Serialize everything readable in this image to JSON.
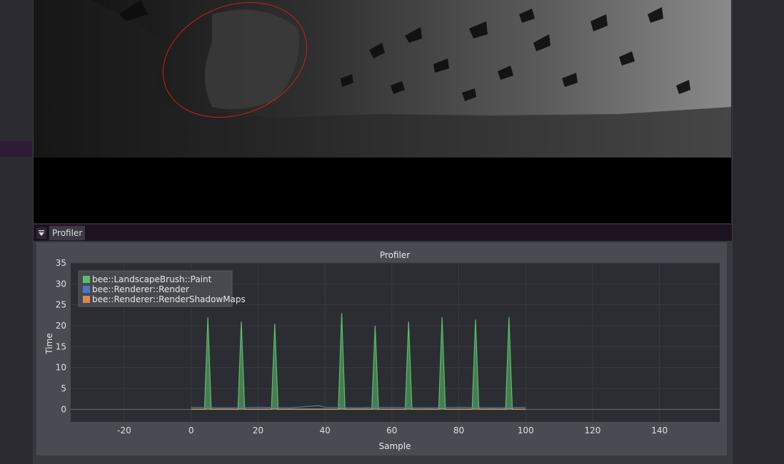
{
  "window": {
    "dock_tab_label": "Profiler"
  },
  "icons": {
    "collapse": "triangle-down-icon"
  },
  "colors": {
    "ellipse": "#cc1f1f",
    "series_paint": "#5bbf6a",
    "series_render": "#4a78c8",
    "series_shadow": "#e0874e"
  },
  "chart_data": {
    "type": "area",
    "title": "Profiler",
    "xlabel": "Sample",
    "ylabel": "Time",
    "xlim": [
      -36,
      158
    ],
    "ylim": [
      -3,
      35
    ],
    "x_ticks": [
      -20,
      0,
      20,
      40,
      60,
      80,
      100,
      120,
      140
    ],
    "y_ticks": [
      0,
      5,
      10,
      15,
      20,
      25,
      30,
      35
    ],
    "grid": true,
    "legend_position": "top-left",
    "series": [
      {
        "name": "bee::LandscapeBrush::Paint",
        "color": "#5bbf6a",
        "points": [
          [
            0,
            0
          ],
          [
            4,
            0
          ],
          [
            5,
            22
          ],
          [
            6,
            0
          ],
          [
            14,
            0
          ],
          [
            15,
            21
          ],
          [
            16,
            0
          ],
          [
            24,
            0
          ],
          [
            25,
            20.5
          ],
          [
            26,
            0
          ],
          [
            44,
            0
          ],
          [
            45,
            23
          ],
          [
            46,
            0
          ],
          [
            54,
            0
          ],
          [
            55,
            20
          ],
          [
            56,
            0
          ],
          [
            64,
            0
          ],
          [
            65,
            21
          ],
          [
            66,
            0
          ],
          [
            74,
            0
          ],
          [
            75,
            22
          ],
          [
            76,
            0
          ],
          [
            84,
            0
          ],
          [
            85,
            21.5
          ],
          [
            86,
            0
          ],
          [
            94,
            0
          ],
          [
            95,
            22
          ],
          [
            96,
            0
          ],
          [
            100,
            0
          ]
        ]
      },
      {
        "name": "bee::Renderer::Render",
        "color": "#4a78c8",
        "points": [
          [
            0,
            0.5
          ],
          [
            10,
            0.4
          ],
          [
            20,
            0.5
          ],
          [
            30,
            0.4
          ],
          [
            38,
            0.9
          ],
          [
            40,
            0.5
          ],
          [
            50,
            0.4
          ],
          [
            60,
            0.5
          ],
          [
            70,
            0.4
          ],
          [
            80,
            0.5
          ],
          [
            90,
            0.4
          ],
          [
            100,
            0.5
          ]
        ]
      },
      {
        "name": "bee::Renderer::RenderShadowMaps",
        "color": "#e0874e",
        "points": [
          [
            0,
            0.1
          ],
          [
            100,
            0.1
          ]
        ]
      }
    ]
  }
}
